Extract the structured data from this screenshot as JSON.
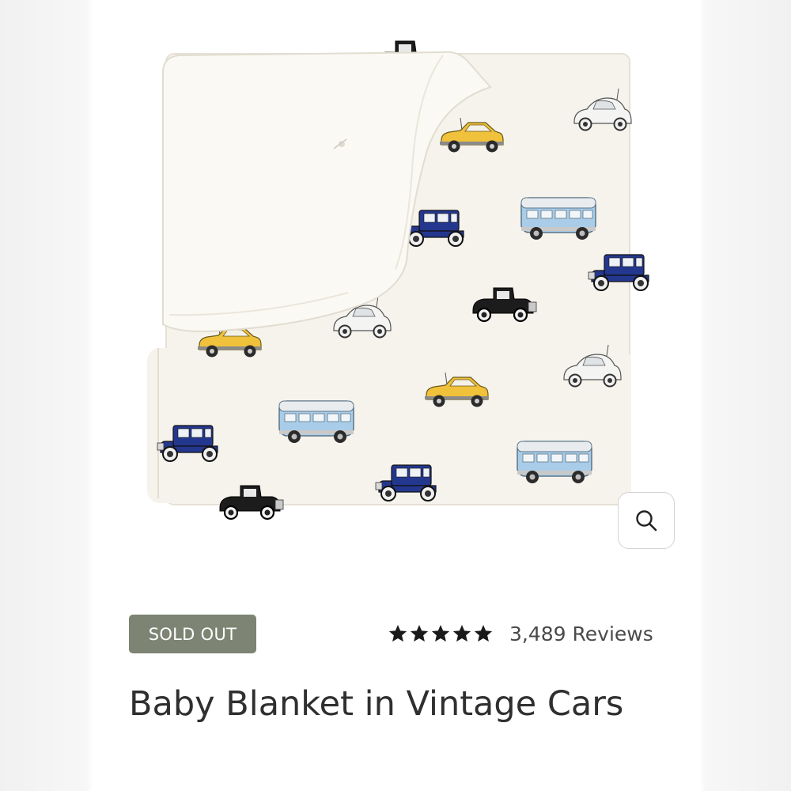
{
  "product": {
    "title": "Baby Blanket in Vintage Cars",
    "status_badge": "SOLD OUT",
    "rating": {
      "stars": 5,
      "reviews_label": "3,489 Reviews"
    },
    "zoom_icon": "magnifier-icon",
    "image_description_icons": [
      "vintage-car-pattern"
    ]
  },
  "colors": {
    "badge_bg": "#7d8473",
    "blanket": "#f7f4ee",
    "car_yellow": "#f2c94c",
    "car_navy": "#1f3a93",
    "car_blue": "#9cc3e6",
    "car_black": "#1a1a1a",
    "text_dark": "#2f2f2f"
  }
}
